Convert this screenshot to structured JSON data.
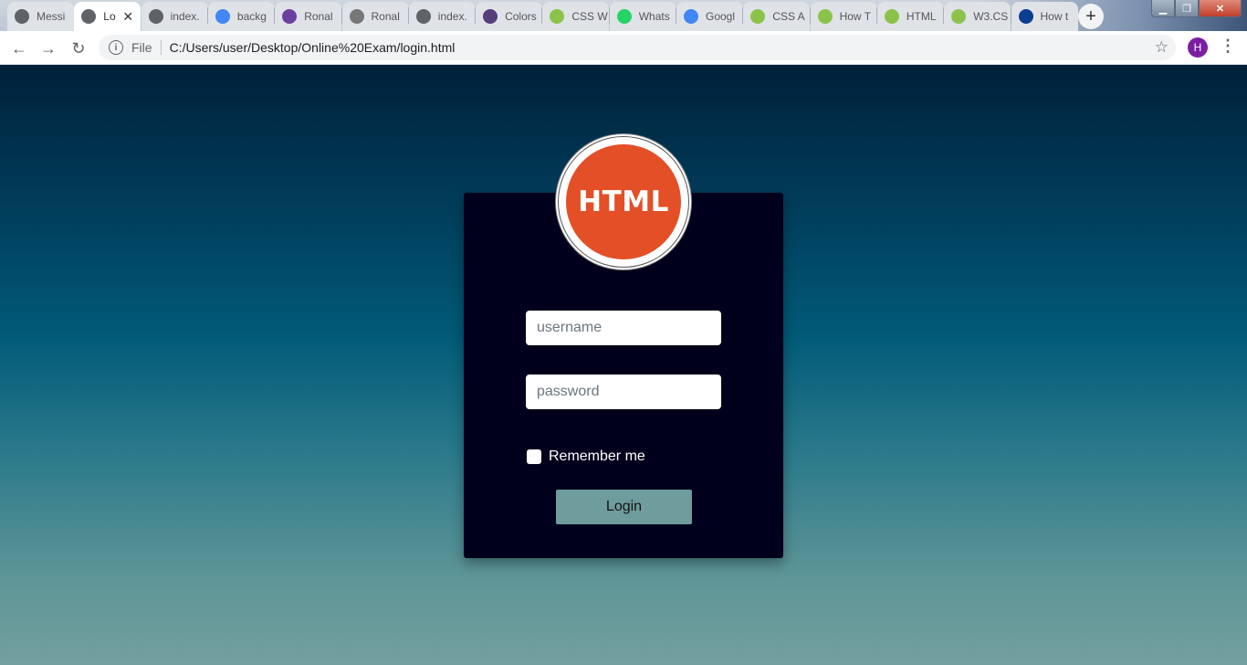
{
  "browser": {
    "tabs": [
      {
        "label": "Messi",
        "icon": "globe-icon",
        "color": "#5f6368"
      },
      {
        "label": "Lo",
        "icon": "globe-icon",
        "color": "#5f6368",
        "active": true
      },
      {
        "label": "index.",
        "icon": "globe-icon",
        "color": "#5f6368"
      },
      {
        "label": "backg",
        "icon": "google-icon",
        "color": "#4285f4"
      },
      {
        "label": "Ronal",
        "icon": "coolors-icon",
        "color": "#6b3fa0"
      },
      {
        "label": "Ronal",
        "icon": "wordpress-icon",
        "color": "#777777"
      },
      {
        "label": "index.",
        "icon": "globe-icon",
        "color": "#5f6368"
      },
      {
        "label": "Colors",
        "icon": "bootstrap-icon",
        "color": "#563d7c"
      },
      {
        "label": "CSS W",
        "icon": "w3schools-icon",
        "color": "#8bc34a"
      },
      {
        "label": "Whats",
        "icon": "whatsapp-icon",
        "color": "#25d366"
      },
      {
        "label": "Googl",
        "icon": "google-translate-icon",
        "color": "#4285f4"
      },
      {
        "label": "CSS A",
        "icon": "w3schools-icon",
        "color": "#8bc34a"
      },
      {
        "label": "How T",
        "icon": "w3schools-icon",
        "color": "#8bc34a"
      },
      {
        "label": "HTML",
        "icon": "w3schools-icon",
        "color": "#8bc34a"
      },
      {
        "label": "W3.CS",
        "icon": "w3schools-icon",
        "color": "#8bc34a"
      },
      {
        "label": "How t",
        "icon": "edge-icon",
        "color": "#0b3d91"
      }
    ],
    "close_glyph": "✕",
    "new_tab_glyph": "+",
    "window_controls": {
      "minimize": "▁",
      "maximize": "❐",
      "close": "✕"
    },
    "address_bar": {
      "scheme_label": "File",
      "url": "C:/Users/user/Desktop/Online%20Exam/login.html"
    },
    "profile_initial": "H"
  },
  "login": {
    "logo_text": "HTML",
    "username_placeholder": "username",
    "password_placeholder": "password",
    "remember_label": "Remember me",
    "login_button": "Login"
  },
  "colors": {
    "card": "#00001c",
    "accent": "#6f9c9d",
    "logo": "#e34f26",
    "bg_top": "#00203a",
    "bg_bottom": "#73a09e"
  }
}
